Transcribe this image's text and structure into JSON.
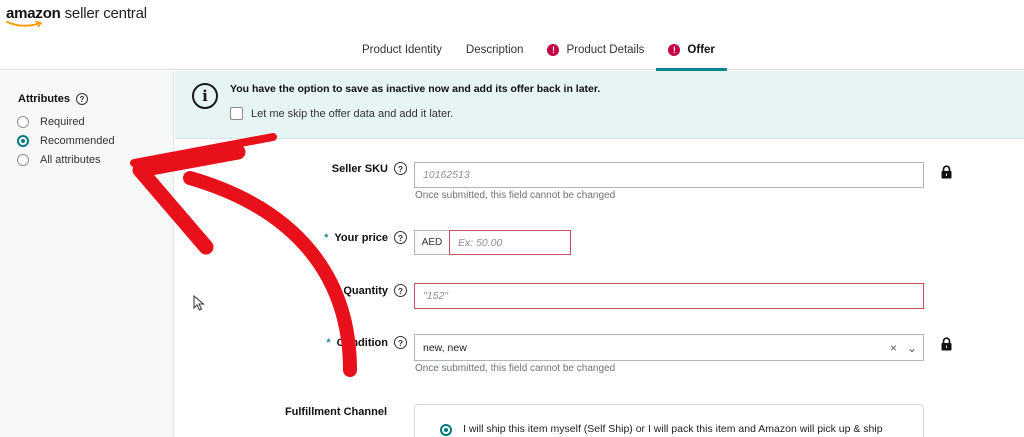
{
  "header": {
    "logo_brand": "amazon",
    "logo_product": " seller central",
    "tabs": [
      {
        "label": "Product Identity",
        "active": false,
        "alert": false
      },
      {
        "label": "Description",
        "active": false,
        "alert": false
      },
      {
        "label": "Product Details",
        "active": false,
        "alert": true
      },
      {
        "label": "Offer",
        "active": true,
        "alert": true
      }
    ],
    "alert_glyph": "!"
  },
  "sidebar": {
    "title": "Attributes",
    "help_glyph": "?",
    "options": [
      {
        "label": "Required",
        "checked": false
      },
      {
        "label": "Recommended",
        "checked": true
      },
      {
        "label": "All attributes",
        "checked": false
      }
    ]
  },
  "banner": {
    "icon_glyph": "i",
    "message": "You have the option to save as inactive now and add its offer back in later.",
    "skip_label": "Let me skip the offer data and add it later.",
    "skip_checked": false
  },
  "form": {
    "help_glyph": "?",
    "required_mark": "*",
    "seller_sku": {
      "label": "Seller SKU",
      "placeholder": "10162513",
      "hint": "Once submitted, this field cannot be changed",
      "locked": true
    },
    "price": {
      "label": "Your price",
      "currency": "AED",
      "placeholder": "Ex: 50.00"
    },
    "quantity": {
      "label": "Quantity",
      "placeholder": "\"152\""
    },
    "condition": {
      "label": "Condition",
      "value": "new, new",
      "clear_glyph": "×",
      "dropdown_glyph": "⌄",
      "hint": "Once submitted, this field cannot be changed",
      "locked": true
    },
    "fulfillment": {
      "label": "Fulfillment Channel",
      "option_text": "I will ship this item myself (Self Ship) or I will pack this item and Amazon will pick up & ship"
    }
  },
  "icons": {
    "lock": "lock-icon",
    "info": "info-icon",
    "help": "help-icon",
    "alert": "alert-icon",
    "cursor": "cursor-icon",
    "annotation": "red-curved-arrow"
  },
  "colors": {
    "accent": "#00878e",
    "alert": "#c40046",
    "banner_bg": "#e6f4f3",
    "error_border": "#c5515d",
    "annotation_red": "#e8101a"
  }
}
